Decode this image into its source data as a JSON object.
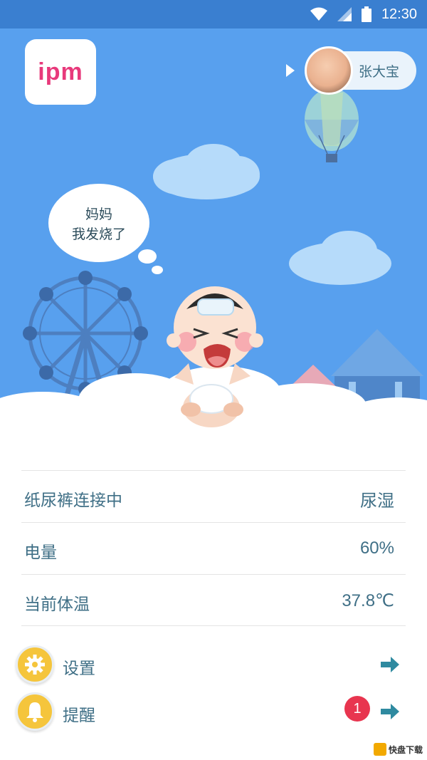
{
  "status_bar": {
    "time": "12:30"
  },
  "header": {
    "logo_text": "ipm",
    "user_name": "张大宝"
  },
  "speech_bubble": {
    "line1": "妈妈",
    "line2": "我发烧了"
  },
  "info_rows": [
    {
      "label": "纸尿裤连接中",
      "value": "尿湿"
    },
    {
      "label": "电量",
      "value": "60%"
    },
    {
      "label": "当前体温",
      "value": "37.8℃"
    }
  ],
  "menu": {
    "settings_label": "设置",
    "reminder_label": "提醒",
    "reminder_badge": "1"
  },
  "watermark": "快盘下载",
  "colors": {
    "hero_bg": "#58a0ee",
    "status_bg": "#3a7fd0",
    "text": "#3f6f86",
    "badge": "#e8354f",
    "accent_icon": "#f5c53c"
  }
}
